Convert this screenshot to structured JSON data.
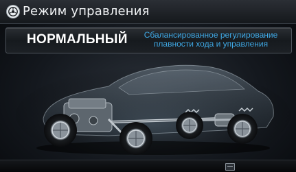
{
  "header": {
    "title": "Режим управления",
    "icon": "drive-mode-icon"
  },
  "mode": {
    "name": "НОРМАЛЬНЫЙ",
    "description": "Сбалансированное регулирование плавности хода и управления"
  },
  "colors": {
    "accent": "#3fa9e6",
    "title_text": "#f1f3f5"
  },
  "bottom_bar": {
    "button_icon": "menu-icon"
  }
}
